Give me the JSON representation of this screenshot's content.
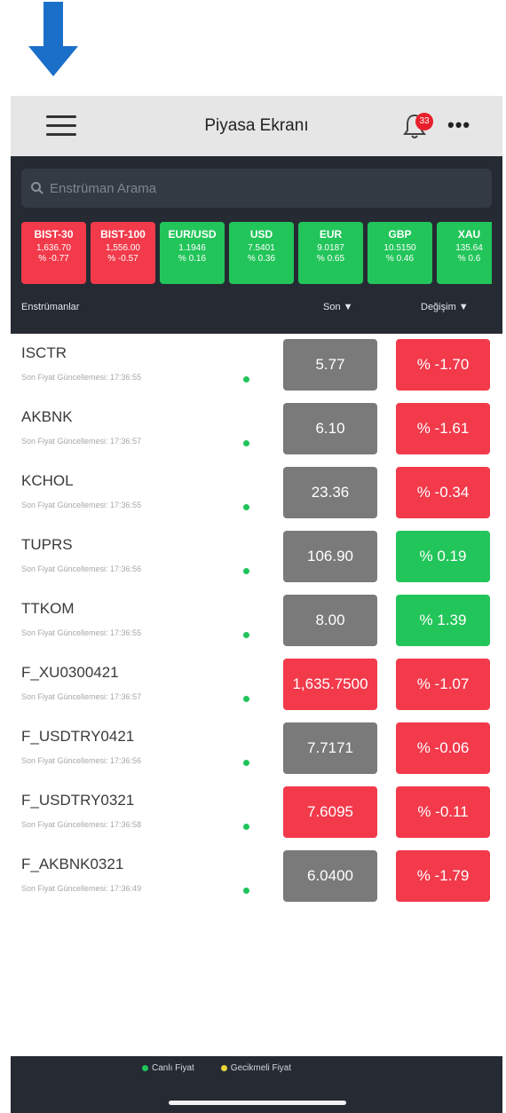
{
  "header": {
    "title": "Piyasa Ekranı",
    "notification_count": "33",
    "more_label": "•••"
  },
  "search": {
    "placeholder": "Enstrüman Arama"
  },
  "tickers": [
    {
      "name": "BIST-30",
      "value": "1,636.70",
      "change": "% -0.77",
      "color": "red"
    },
    {
      "name": "BIST-100",
      "value": "1,556.00",
      "change": "% -0.57",
      "color": "red"
    },
    {
      "name": "EUR/USD",
      "value": "1.1946",
      "change": "% 0.16",
      "color": "green"
    },
    {
      "name": "USD",
      "value": "7.5401",
      "change": "% 0.36",
      "color": "green"
    },
    {
      "name": "EUR",
      "value": "9.0187",
      "change": "% 0.65",
      "color": "green"
    },
    {
      "name": "GBP",
      "value": "10.5150",
      "change": "% 0.46",
      "color": "green"
    },
    {
      "name": "XAU",
      "value": "135.64",
      "change": "% 0.6",
      "color": "green"
    }
  ],
  "columns": {
    "instruments": "Enstrümanlar",
    "last": "Son ▼",
    "change": "Değişim ▼"
  },
  "rows": [
    {
      "symbol": "ISCTR",
      "updated": "Son Fiyat Güncellemesi: 17:36:55",
      "price": "5.77",
      "price_color": "grey",
      "change": "% -1.70",
      "change_color": "red"
    },
    {
      "symbol": "AKBNK",
      "updated": "Son Fiyat Güncellemesi: 17:36:57",
      "price": "6.10",
      "price_color": "grey",
      "change": "% -1.61",
      "change_color": "red"
    },
    {
      "symbol": "KCHOL",
      "updated": "Son Fiyat Güncellemesi: 17:36:55",
      "price": "23.36",
      "price_color": "grey",
      "change": "% -0.34",
      "change_color": "red"
    },
    {
      "symbol": "TUPRS",
      "updated": "Son Fiyat Güncellemesi: 17:36:56",
      "price": "106.90",
      "price_color": "grey",
      "change": "% 0.19",
      "change_color": "green"
    },
    {
      "symbol": "TTKOM",
      "updated": "Son Fiyat Güncellemesi: 17:36:55",
      "price": "8.00",
      "price_color": "grey",
      "change": "% 1.39",
      "change_color": "green"
    },
    {
      "symbol": "F_XU0300421",
      "updated": "Son Fiyat Güncellemesi: 17:36:57",
      "price": "1,635.7500",
      "price_color": "red",
      "change": "% -1.07",
      "change_color": "red"
    },
    {
      "symbol": "F_USDTRY0421",
      "updated": "Son Fiyat Güncellemesi: 17:36:56",
      "price": "7.7171",
      "price_color": "grey",
      "change": "% -0.06",
      "change_color": "red"
    },
    {
      "symbol": "F_USDTRY0321",
      "updated": "Son Fiyat Güncellemesi: 17:36:58",
      "price": "7.6095",
      "price_color": "red",
      "change": "% -0.11",
      "change_color": "red"
    },
    {
      "symbol": "F_AKBNK0321",
      "updated": "Son Fiyat Güncellemesi: 17:36:49",
      "price": "6.0400",
      "price_color": "grey",
      "change": "% -1.79",
      "change_color": "red"
    }
  ],
  "legend": {
    "live": "Canlı Fiyat",
    "delayed": "Gecikmeli Fiyat"
  },
  "colors": {
    "red": "#f23a4b",
    "green": "#22c55a",
    "grey": "#7a7a7a",
    "live_dot": "#1fc45a",
    "delayed_dot": "#e8d63a",
    "dark_bg": "#252a33",
    "arrow": "#1a6fc9"
  },
  "icons": {
    "annotation_arrow": "down-arrow-icon",
    "menu": "hamburger-menu-icon",
    "notifications": "bell-icon",
    "search": "search-icon"
  }
}
